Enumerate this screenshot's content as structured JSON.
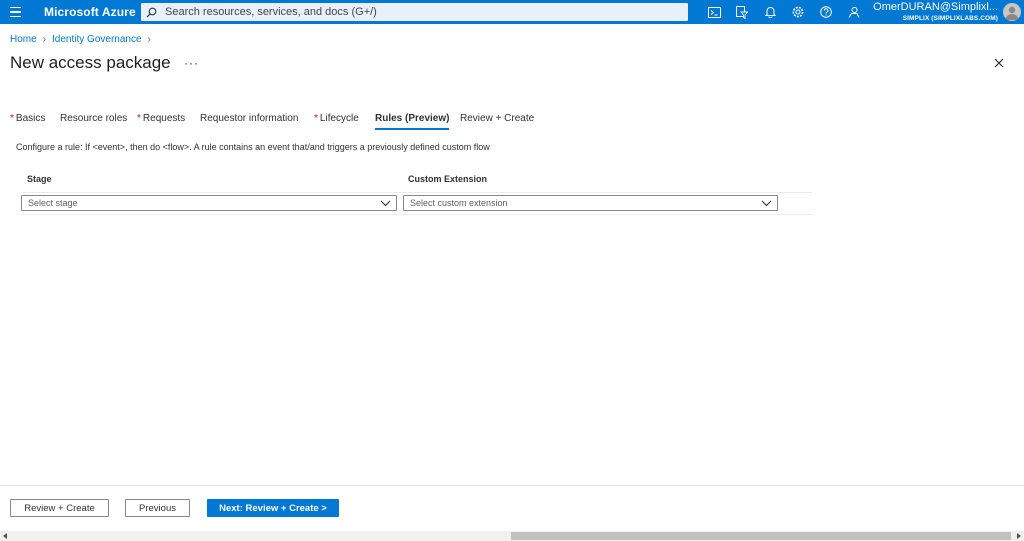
{
  "topbar": {
    "brand": "Microsoft Azure",
    "search_placeholder": "Search resources, services, and docs (G+/)",
    "icons": [
      "menu-icon",
      "cloud-shell-icon",
      "directory-filter-icon",
      "notifications-icon",
      "settings-icon",
      "help-icon",
      "feedback-icon"
    ],
    "user_name": "OmerDURAN@Simplixl...",
    "tenant": "SIMPLIX (SIMPLIXLABS.COM)"
  },
  "breadcrumb": {
    "home": "Home",
    "identity_governance": "Identity Governance"
  },
  "page": {
    "title": "New access package",
    "more": "···"
  },
  "tabs": [
    {
      "label": "Basics",
      "required": true
    },
    {
      "label": "Resource roles",
      "required": false
    },
    {
      "label": "Requests",
      "required": true
    },
    {
      "label": "Requestor information",
      "required": false
    },
    {
      "label": "Lifecycle",
      "required": true
    },
    {
      "label": "Rules (Preview)",
      "required": false,
      "active": true
    },
    {
      "label": "Review + Create",
      "required": false
    }
  ],
  "required_marker": "*",
  "description": "Configure a rule: If <event>, then do <flow>. A rule contains an event that/and triggers a previously defined custom flow",
  "grid": {
    "stage_header": "Stage",
    "extension_header": "Custom Extension",
    "stage_placeholder": "Select stage",
    "extension_placeholder": "Select custom extension"
  },
  "footer": {
    "review_create": "Review + Create",
    "previous": "Previous",
    "next": "Next: Review + Create >"
  },
  "colors": {
    "accent": "#0078d4",
    "required": "#a4262c"
  }
}
